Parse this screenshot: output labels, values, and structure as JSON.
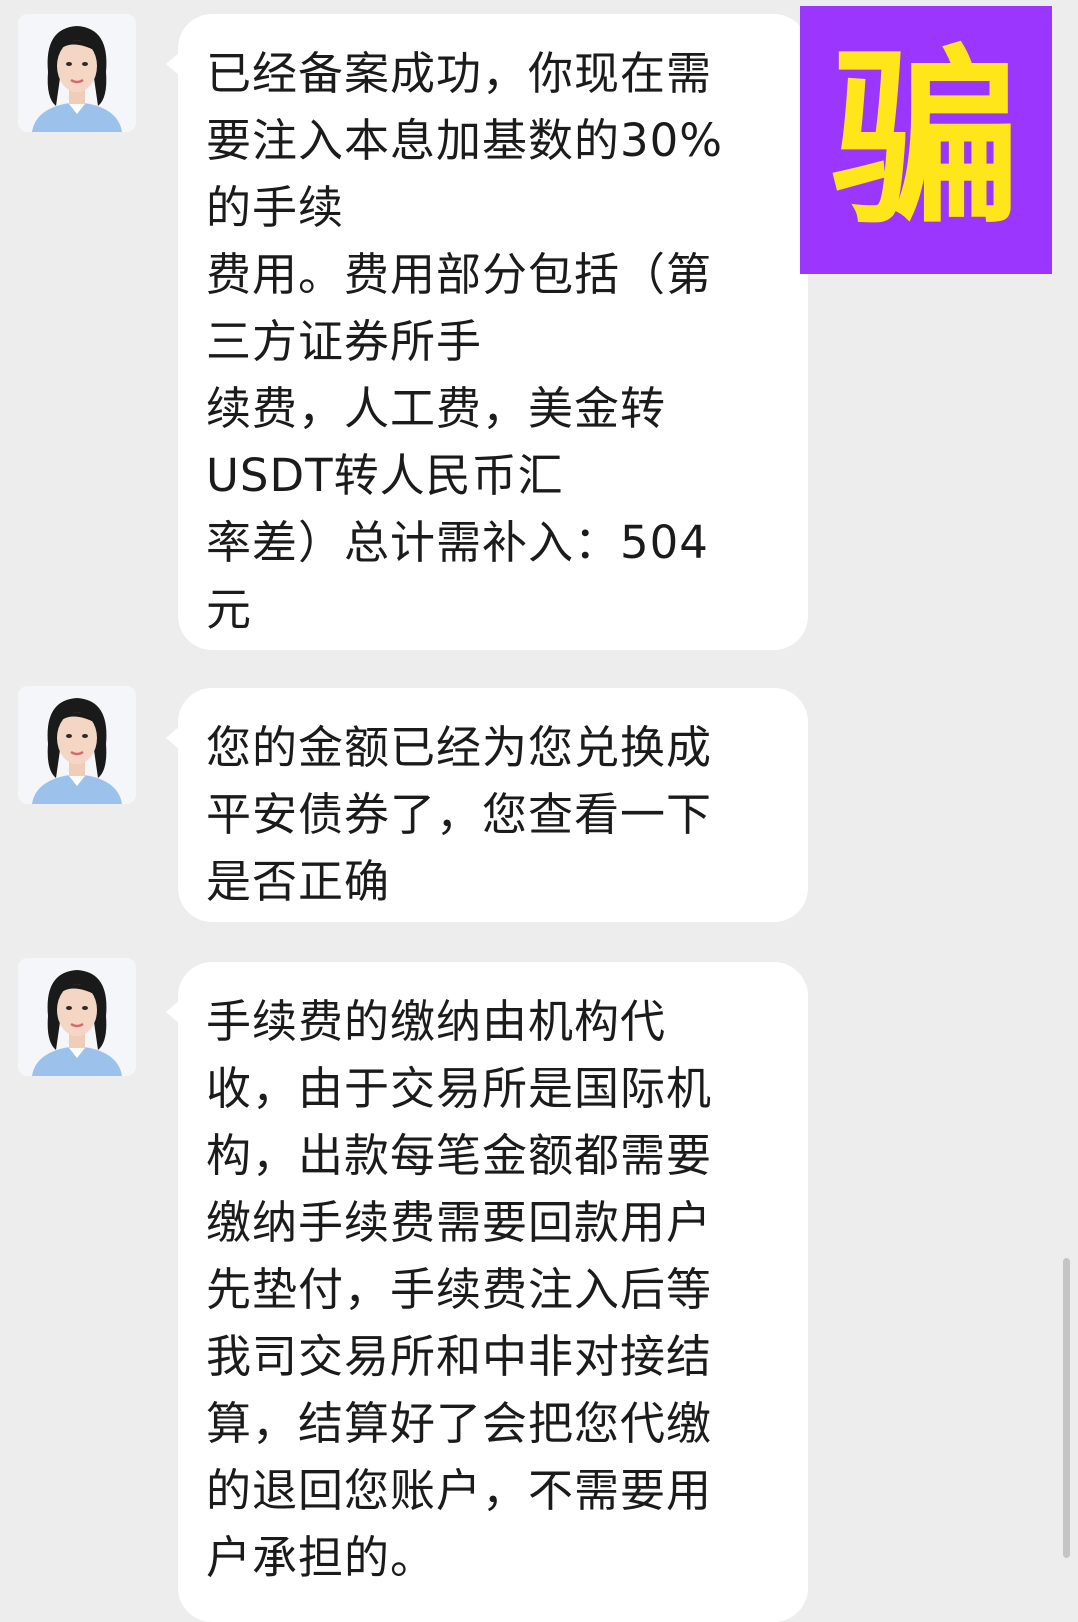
{
  "stamp": {
    "text": "骗",
    "background": "#9b36ff",
    "color": "#ffe61a"
  },
  "messages": [
    {
      "sender": "incoming",
      "avatar_icon": "woman-portrait-avatar",
      "text": "已经备案成功，你现在需\n要注入本息加基数的30%\n的手续\n费用。费用部分包括（第\n三方证券所手\n续费，人工费，美金转\nUSDT转人民币汇\n率差）总计需补入：504\n元"
    },
    {
      "sender": "incoming",
      "avatar_icon": "woman-portrait-avatar",
      "text": "您的金额已经为您兑换成\n平安债券了，您查看一下\n是否正确"
    },
    {
      "sender": "incoming",
      "avatar_icon": "woman-portrait-avatar",
      "text": "手续费的缴纳由机构代\n收，由于交易所是国际机\n构，出款每笔金额都需要\n缴纳手续费需要回款用户\n先垫付，手续费注入后等\n我司交易所和中非对接结\n算，结算好了会把您代缴\n的退回您账户，不需要用\n户承担的。"
    }
  ]
}
